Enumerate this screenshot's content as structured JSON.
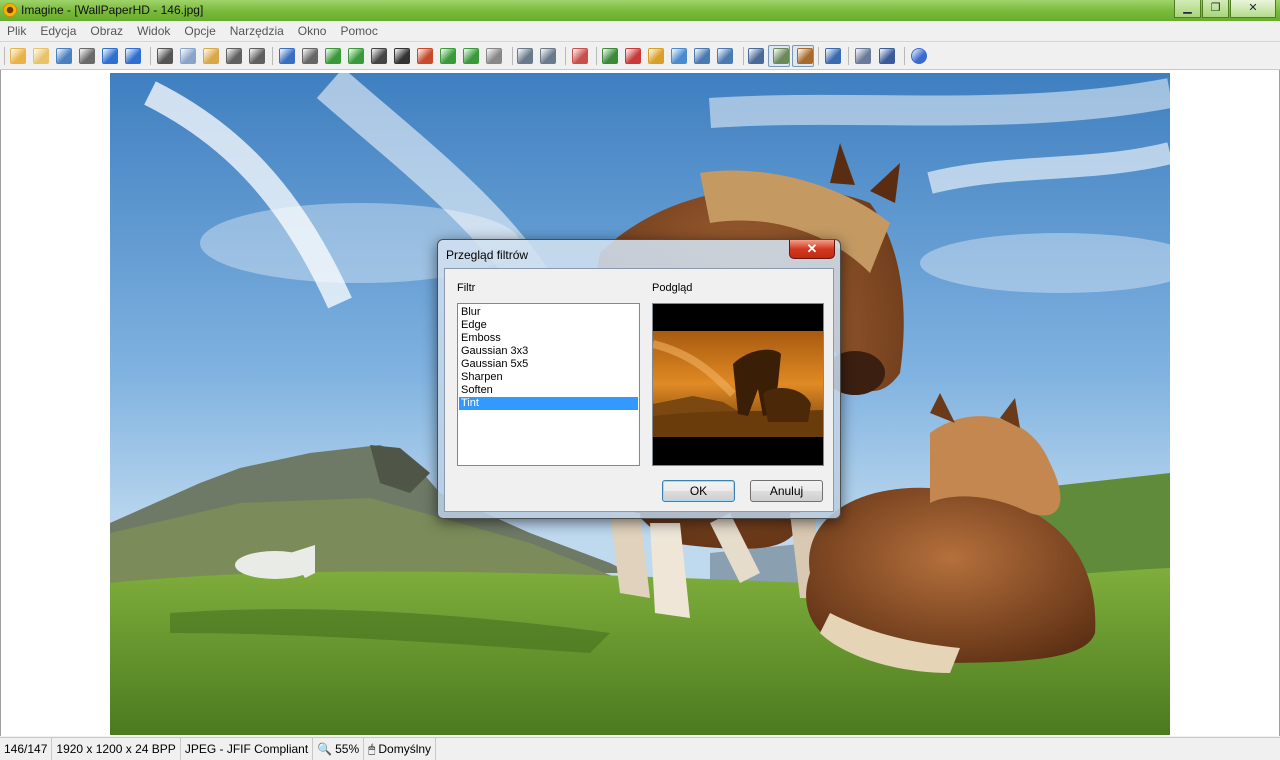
{
  "window": {
    "title": "Imagine - [WallPaperHD - 146.jpg]"
  },
  "menu": [
    "Plik",
    "Edycja",
    "Obraz",
    "Widok",
    "Opcje",
    "Narzędzia",
    "Okno",
    "Pomoc"
  ],
  "toolbar": {
    "icons": [
      "new-icon",
      "open-icon",
      "save-icon",
      "print-icon",
      "previous-icon",
      "next-icon",
      "cut-icon",
      "copy-icon",
      "paste-icon",
      "undo-icon",
      "redo-icon",
      "info-icon",
      "capture-icon",
      "resize-icon",
      "crop-icon",
      "grayscale-icon",
      "negative-icon",
      "effects-icon",
      "rotate-icon",
      "flip-icon",
      "filter-icon",
      "zoom-fit-icon",
      "zoom-actual-icon",
      "slideshow-icon",
      "zoom-in-icon",
      "zoom-out-icon",
      "zoom-tool-icon",
      "thumbnails-icon",
      "view-mode-icon",
      "fullscreen-icon",
      "monitor-icon",
      "browse-icon",
      "edit-icon",
      "settings-icon",
      "batch-icon",
      "plugins-icon",
      "help-icon"
    ]
  },
  "status": {
    "index": "146/147",
    "dimensions": "1920 x 1200 x 24 BPP",
    "format": "JPEG - JFIF Compliant",
    "zoom": "55%",
    "profile": "Domyślny"
  },
  "dialog": {
    "title": "Przegląd filtrów",
    "filter_label": "Filtr",
    "preview_label": "Podgląd",
    "filters": [
      "Blur",
      "Edge",
      "Emboss",
      "Gaussian 3x3",
      "Gaussian 5x5",
      "Sharpen",
      "Soften",
      "Tint"
    ],
    "selected_filter": "Tint",
    "ok_label": "OK",
    "cancel_label": "Anuluj",
    "close_label": "✕"
  },
  "colors": {
    "selection": "#3399ff",
    "titlebar": "#78b93a"
  }
}
